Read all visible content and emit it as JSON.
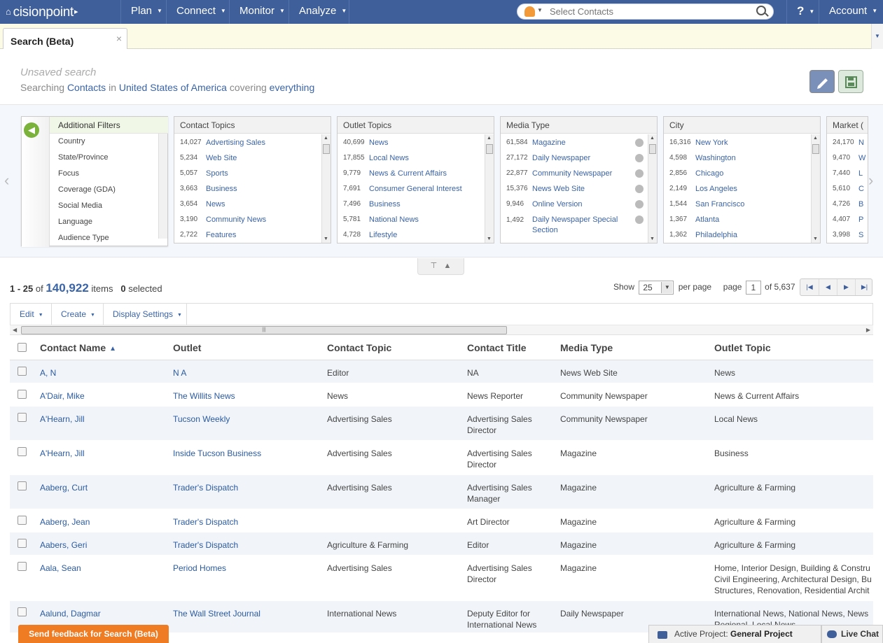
{
  "nav": {
    "logo": "cisionpoint",
    "items": [
      "Plan",
      "Connect",
      "Monitor",
      "Analyze"
    ],
    "search_placeholder": "Select Contacts",
    "help": "?",
    "account": "Account"
  },
  "tabs": {
    "active": "Search (Beta)",
    "close": "×"
  },
  "search": {
    "title": "Unsaved search",
    "prefix": "Searching",
    "entity": "Contacts",
    "in_word": "in",
    "country": "United States of America",
    "covering_word": "covering",
    "scope": "everything"
  },
  "filters": {
    "additional": {
      "title": "Additional Filters",
      "items": [
        "Country",
        "State/Province",
        "Focus",
        "Coverage (GDA)",
        "Social Media",
        "Language",
        "Audience Type"
      ]
    },
    "panels": [
      {
        "title": "Contact Topics",
        "rows": [
          {
            "count": "14,027",
            "label": "Advertising Sales"
          },
          {
            "count": "5,234",
            "label": "Web Site"
          },
          {
            "count": "5,057",
            "label": "Sports"
          },
          {
            "count": "3,663",
            "label": "Business"
          },
          {
            "count": "3,654",
            "label": "News"
          },
          {
            "count": "3,190",
            "label": "Community News"
          },
          {
            "count": "2,722",
            "label": "Features"
          }
        ]
      },
      {
        "title": "Outlet Topics",
        "rows": [
          {
            "count": "40,699",
            "label": "News"
          },
          {
            "count": "17,855",
            "label": "Local News"
          },
          {
            "count": "9,779",
            "label": "News & Current Affairs"
          },
          {
            "count": "7,691",
            "label": "Consumer General Interest"
          },
          {
            "count": "7,496",
            "label": "Business"
          },
          {
            "count": "5,781",
            "label": "National News"
          },
          {
            "count": "4,728",
            "label": "Lifestyle"
          }
        ]
      },
      {
        "title": "Media Type",
        "rows": [
          {
            "count": "61,584",
            "label": "Magazine"
          },
          {
            "count": "27,172",
            "label": "Daily Newspaper"
          },
          {
            "count": "22,877",
            "label": "Community Newspaper"
          },
          {
            "count": "15,376",
            "label": "News Web Site"
          },
          {
            "count": "9,946",
            "label": "Online Version"
          },
          {
            "count": "1,492",
            "label": "Daily Newspaper Special Section"
          }
        ]
      },
      {
        "title": "City",
        "rows": [
          {
            "count": "16,316",
            "label": "New York"
          },
          {
            "count": "4,598",
            "label": "Washington"
          },
          {
            "count": "2,856",
            "label": "Chicago"
          },
          {
            "count": "2,149",
            "label": "Los Angeles"
          },
          {
            "count": "1,544",
            "label": "San Francisco"
          },
          {
            "count": "1,367",
            "label": "Atlanta"
          },
          {
            "count": "1,362",
            "label": "Philadelphia"
          }
        ]
      },
      {
        "title": "Market (",
        "rows": [
          {
            "count": "24,170",
            "label": "N"
          },
          {
            "count": "9,470",
            "label": "W"
          },
          {
            "count": "7,440",
            "label": "L"
          },
          {
            "count": "5,610",
            "label": "C"
          },
          {
            "count": "4,726",
            "label": "B"
          },
          {
            "count": "4,407",
            "label": "P"
          },
          {
            "count": "3,998",
            "label": "S"
          }
        ]
      }
    ]
  },
  "results": {
    "range": "1 - 25",
    "of_word": "of",
    "total": "140,922",
    "items_word": "items",
    "selected": "0",
    "selected_word": "selected"
  },
  "pager": {
    "show_label": "Show",
    "per_page": "25",
    "per_page_label": "per page",
    "page_label": "page",
    "page": "1",
    "of_pages": "of 5,637"
  },
  "toolbar": [
    "Edit",
    "Create",
    "Display Settings"
  ],
  "table": {
    "columns": [
      "Contact Name",
      "Outlet",
      "Contact Topic",
      "Contact Title",
      "Media Type",
      "Outlet Topic"
    ],
    "rows": [
      {
        "name": "A, N",
        "outlet": "N A",
        "topic": "Editor",
        "title": "NA",
        "media": "News Web Site",
        "otopic": "News"
      },
      {
        "name": "A'Dair, Mike",
        "outlet": "The Willits News",
        "topic": "News",
        "title": "News Reporter",
        "media": "Community Newspaper",
        "otopic": "News & Current Affairs"
      },
      {
        "name": "A'Hearn, Jill",
        "outlet": "Tucson Weekly",
        "topic": "Advertising Sales",
        "title": "Advertising Sales Director",
        "media": "Community Newspaper",
        "otopic": "Local News"
      },
      {
        "name": "A'Hearn, Jill",
        "outlet": "Inside Tucson Business",
        "topic": "Advertising Sales",
        "title": "Advertising Sales Director",
        "media": "Magazine",
        "otopic": "Business"
      },
      {
        "name": "Aaberg, Curt",
        "outlet": "Trader's Dispatch",
        "topic": "Advertising Sales",
        "title": "Advertising Sales Manager",
        "media": "Magazine",
        "otopic": "Agriculture & Farming"
      },
      {
        "name": "Aaberg, Jean",
        "outlet": "Trader's Dispatch",
        "topic": "",
        "title": "Art Director",
        "media": "Magazine",
        "otopic": "Agriculture & Farming"
      },
      {
        "name": "Aabers, Geri",
        "outlet": "Trader's Dispatch",
        "topic": "Agriculture & Farming",
        "title": "Editor",
        "media": "Magazine",
        "otopic": "Agriculture & Farming"
      },
      {
        "name": "Aala, Sean",
        "outlet": "Period Homes",
        "topic": "Advertising Sales",
        "title": "Advertising Sales Director",
        "media": "Magazine",
        "otopic": "Home, Interior Design, Building & Constru Civil Engineering, Architectural Design, Bu Structures, Renovation, Residential Archit"
      },
      {
        "name": "Aalund, Dagmar",
        "outlet": "The Wall Street Journal",
        "topic": "International News",
        "title": "Deputy Editor for International News",
        "media": "Daily Newspaper",
        "otopic": "International News, National News, News Regional, Local News"
      }
    ]
  },
  "footer": {
    "feedback": "Send feedback for Search (Beta)",
    "active_label": "Active Project:",
    "active_project": "General Project",
    "live_chat": "Live Chat"
  }
}
